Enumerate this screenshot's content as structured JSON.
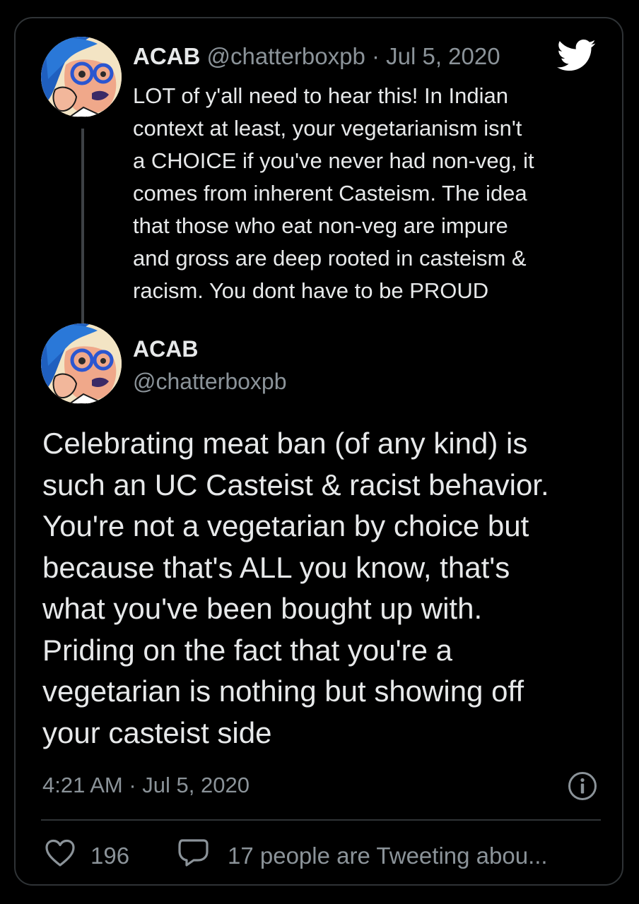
{
  "parent_tweet": {
    "name": "ACAB",
    "handle": "@chatterboxpb",
    "separator": "·",
    "date": "Jul 5, 2020",
    "text": "LOT of y'all need to hear this! In Indian\ncontext at least, your vegetarianism isn't\na CHOICE if you've never had non-veg, it\ncomes from inherent Casteism. The idea\nthat those who eat non-veg are impure\nand gross are deep rooted in casteism &\nracism. You dont have to be PROUD"
  },
  "main_tweet": {
    "name": "ACAB",
    "handle": "@chatterboxpb",
    "text": "Celebrating meat ban (of any kind) is\nsuch an UC Casteist & racist behavior.\nYou're not a vegetarian by choice but\nbecause that's ALL you know, that's\nwhat you've been bought up with.\nPriding on the fact that you're a\nvegetarian is nothing but showing off\nyour casteist side",
    "timestamp": "4:21 AM · Jul 5, 2020"
  },
  "actions": {
    "like_count": "196",
    "reply_text": "17 people are Tweeting abou..."
  },
  "icons": {
    "brand": "twitter-bird-icon",
    "info": "info-icon",
    "like": "heart-icon",
    "reply": "speech-bubble-icon"
  },
  "colors": {
    "background": "#000000",
    "text_primary": "#e7e9ea",
    "text_secondary": "#8b9399",
    "border": "#2f3336",
    "brand": "#ffffff"
  }
}
